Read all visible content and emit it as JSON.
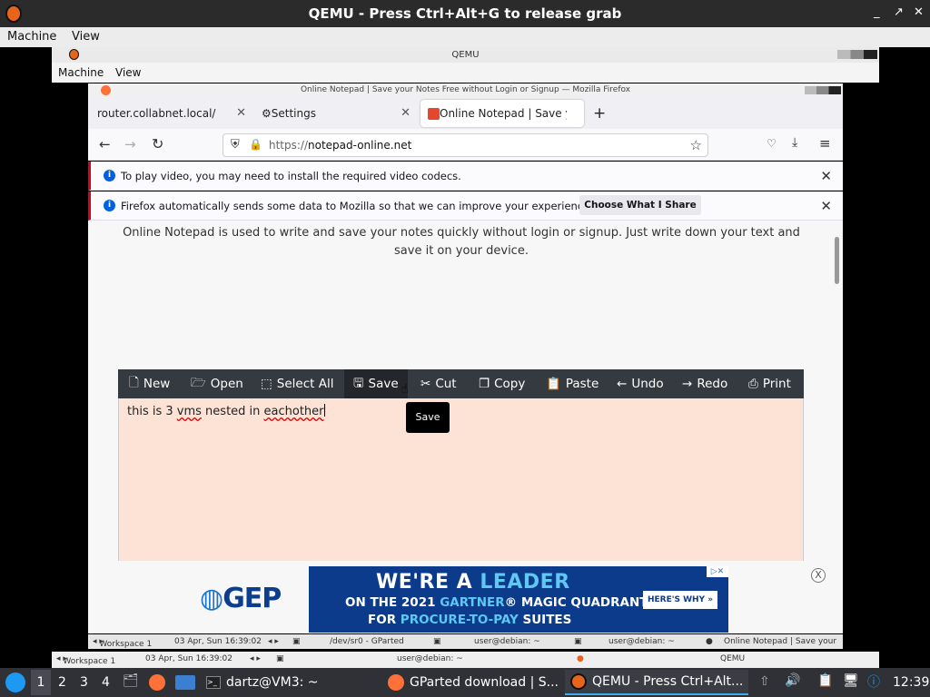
{
  "outer_window": {
    "title": "QEMU - Press Ctrl+Alt+G to release grab",
    "menu": [
      "Machine",
      "View"
    ]
  },
  "inner_window": {
    "title": "QEMU",
    "menu": [
      "Machine",
      "View"
    ]
  },
  "firefox": {
    "window_title": "Online Notepad | Save your Notes Free without Login or Signup — Mozilla Firefox",
    "tabs": [
      {
        "label": "router.collabnet.local/"
      },
      {
        "label": "Settings"
      },
      {
        "label": "Online Notepad | Save yo"
      }
    ],
    "new_tab": "+",
    "url_prefix": "https://",
    "url_domain": "notepad-online.net",
    "notifications": [
      {
        "message": "To play video, you may need to install the required video codecs."
      },
      {
        "message": "Firefox automatically sends some data to Mozilla so that we can improve your experience.",
        "button": "Choose What I Share"
      }
    ]
  },
  "page": {
    "intro": "Online Notepad is used to write and save your notes quickly without login or signup. Just write down your text and save it on your device.",
    "toolbar": [
      {
        "label": "New",
        "icon": "file-icon"
      },
      {
        "label": "Open",
        "icon": "folder-icon"
      },
      {
        "label": "Select All",
        "icon": "select-all-icon"
      },
      {
        "label": "Save",
        "icon": "save-icon"
      },
      {
        "label": "Cut",
        "icon": "scissors-icon"
      },
      {
        "label": "Copy",
        "icon": "copy-icon"
      },
      {
        "label": "Paste",
        "icon": "paste-icon"
      },
      {
        "label": "Undo",
        "icon": "arrow-left-icon"
      },
      {
        "label": "Redo",
        "icon": "arrow-right-icon"
      },
      {
        "label": "Print",
        "icon": "print-icon"
      }
    ],
    "editor": {
      "text_a": "this is 3 ",
      "text_b": "vms",
      "text_c": " nested in ",
      "text_d": "eachother"
    },
    "tooltip": "Save",
    "ad": {
      "logo": "GEP",
      "line1_a": "WE'RE A ",
      "line1_b": "LEADER",
      "line2_a": "ON THE 2021 ",
      "line2_b": "GARTNER",
      "line2_c": "® MAGIC QUADRANT™",
      "line3_a": "FOR ",
      "line3_b": "PROCURE-TO-PAY",
      "line3_c": " SUITES",
      "cta": "HERE'S WHY »",
      "close": "X"
    }
  },
  "inner_panel": {
    "workspace": "Workspace 1",
    "datetime": "03 Apr, Sun 16:39:02",
    "items": [
      "/dev/sr0 - GParted",
      "user@debian: ~",
      "user@debian: ~",
      "Online Notepad | Save your"
    ]
  },
  "mid_panel": {
    "workspace": "Workspace 1",
    "datetime": "03 Apr, Sun 16:39:02",
    "items": [
      "user@debian: ~",
      "QEMU"
    ]
  },
  "taskbar": {
    "workspaces": [
      "1",
      "2",
      "3",
      "4"
    ],
    "tasks": [
      {
        "label": "dartz@VM3: ~"
      },
      {
        "label": "GParted download | S..."
      },
      {
        "label": "QEMU - Press Ctrl+Alt..."
      }
    ],
    "clock": "12:39"
  },
  "colors": {
    "toolbar_bg": "#343a40",
    "editor_bg": "#fde2d6",
    "accent": "#3daee9",
    "ad_bg": "#0c3b8c",
    "ad_highlight": "#5ec8f2"
  }
}
